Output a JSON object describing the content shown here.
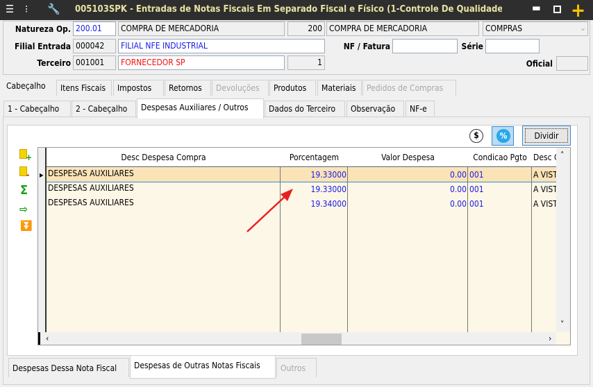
{
  "window": {
    "title": "005103SPK - Entradas de Notas Fiscais Em Separado Fiscal e Físico (1-Controle De Qualidade",
    "icons": [
      "menu-icon",
      "traffic-light-icon",
      "wrench-icon",
      "minimize-icon",
      "maximize-icon",
      "plus-icon"
    ]
  },
  "header": {
    "natureza_label": "Natureza Op.",
    "natureza_code": "200.01",
    "natureza_desc": "COMPRA DE MERCADORIA",
    "code2": "200",
    "desc2": "COMPRA DE MERCADORIA",
    "tipo": "COMPRAS",
    "filial_label": "Filial Entrada",
    "filial_code": "000042",
    "filial_desc": "FILIAL NFE INDUSTRIAL",
    "nf_label": "NF / Fatura",
    "nf_value": "",
    "serie_label": "Série",
    "serie_value": "",
    "terceiro_label": "Terceiro",
    "terceiro_code": "001001",
    "terceiro_desc": "FORNECEDOR SP",
    "terceiro_num": "1",
    "oficial_label": "Oficial",
    "oficial_value": ""
  },
  "main_tabs": [
    {
      "label": "Cabeçalho",
      "active": true
    },
    {
      "label": "Itens Fiscais"
    },
    {
      "label": "Impostos"
    },
    {
      "label": "Retornos"
    },
    {
      "label": "Devoluções",
      "disabled": true
    },
    {
      "label": "Produtos"
    },
    {
      "label": "Materiais"
    },
    {
      "label": "Pedidos de Compras",
      "disabled": true
    }
  ],
  "sub_tabs": [
    {
      "label": "1 - Cabeçalho"
    },
    {
      "label": "2 - Cabeçalho"
    },
    {
      "label": "Despesas Auxiliares / Outros",
      "active": true
    },
    {
      "label": "Dados do Terceiro"
    },
    {
      "label": "Observação"
    },
    {
      "label": "NF-e"
    }
  ],
  "toolbar": {
    "dividir_label": "Dividir",
    "currency_icon": "dollar-icon",
    "percent_icon": "percent-icon"
  },
  "side_icons": [
    "add-row-icon",
    "remove-row-icon",
    "sum-icon",
    "export-icon",
    "move-down-icon"
  ],
  "grid": {
    "columns": [
      "Desc Despesa Compra",
      "Porcentagem",
      "Valor Despesa",
      "Condicao Pgto",
      "Desc C"
    ],
    "rows": [
      [
        "DESPESAS AUXILIARES",
        "19.33000",
        "0.00",
        "001",
        "A VISTA"
      ],
      [
        "DESPESAS AUXILIARES",
        "19.33000",
        "0.00",
        "001",
        "A VISTA"
      ],
      [
        "DESPESAS AUXILIARES",
        "19.34000",
        "0.00",
        "001",
        "A VISTA"
      ]
    ]
  },
  "bottom_tabs": [
    {
      "label": "Despesas Dessa Nota Fiscal"
    },
    {
      "label": "Despesas de Outras Notas Fiscais",
      "active": true
    },
    {
      "label": "Outros",
      "disabled": true
    }
  ],
  "colors": {
    "title_bg": "#2e2e2e",
    "title_text": "#e6e3a4",
    "grid_bg": "#fdf7e7",
    "selected_row": "#fbe3b8",
    "value_blue": "#1a1ae6",
    "annotation_arrow": "#e82020"
  }
}
